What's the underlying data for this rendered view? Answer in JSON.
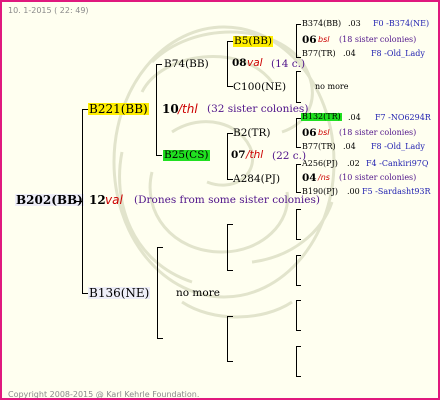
{
  "header": "10. 1-2015 ( 22: 49)",
  "footer": "Copyright 2008-2015 @ Karl Kehrle Foundation.",
  "root": {
    "label": "B202(BB)",
    "num": "12",
    "hive": "val",
    "note": "(Drones from some sister colonies)"
  },
  "sire": {
    "label": "B221(BB)",
    "num": "10",
    "hive": "/thl",
    "note": "(32 sister colonies)"
  },
  "dam": {
    "label": "B136(NE)",
    "note": "no more"
  },
  "sire_sire": {
    "label": "B74(BB)",
    "num": "08",
    "hive": "val",
    "note": "(14 c.)"
  },
  "sire_dam": {
    "label": "B25(CS)",
    "num": "07",
    "hive": "/thl",
    "note": "(22 c.)"
  },
  "g3": {
    "b5": {
      "label": "B5(BB)"
    },
    "c100": {
      "label": "C100(NE)",
      "note": "no more"
    },
    "b2": {
      "label": "B2(TR)"
    },
    "a284": {
      "label": "A284(PJ)"
    }
  },
  "g4": [
    {
      "label": "B374(BB)",
      "val": ".03",
      "pedigree": "F0 -B374(NE)"
    },
    {
      "num": "06",
      "hive": "bsl",
      "note": "(18 sister colonies)"
    },
    {
      "label": "B77(TR)",
      "val": ".04",
      "pedigree": "F8 -Old_Lady"
    },
    {
      "label": "B132(TR)",
      "val": ".04",
      "pedigree": "F7 -NO6294R"
    },
    {
      "num": "06",
      "hive": "bsl",
      "note": "(18 sister colonies)"
    },
    {
      "label": "B77(TR)",
      "val": ".04",
      "pedigree": "F8 -Old_Lady"
    },
    {
      "label": "A256(PJ)",
      "val": ".02",
      "pedigree": "F4 -Cankiri97Q"
    },
    {
      "num": "04",
      "hive": "/ns",
      "note": "(10 sister colonies)"
    },
    {
      "label": "B190(PJ)",
      "val": ".00",
      "pedigree": "F5 -Sardasht93R"
    }
  ],
  "colors": {
    "border": "#e0197e",
    "yellow": "#ffee00",
    "green": "#20e020",
    "pedigree": "#1f1fb0",
    "note": "#50148a",
    "hive": "#cc0000"
  }
}
